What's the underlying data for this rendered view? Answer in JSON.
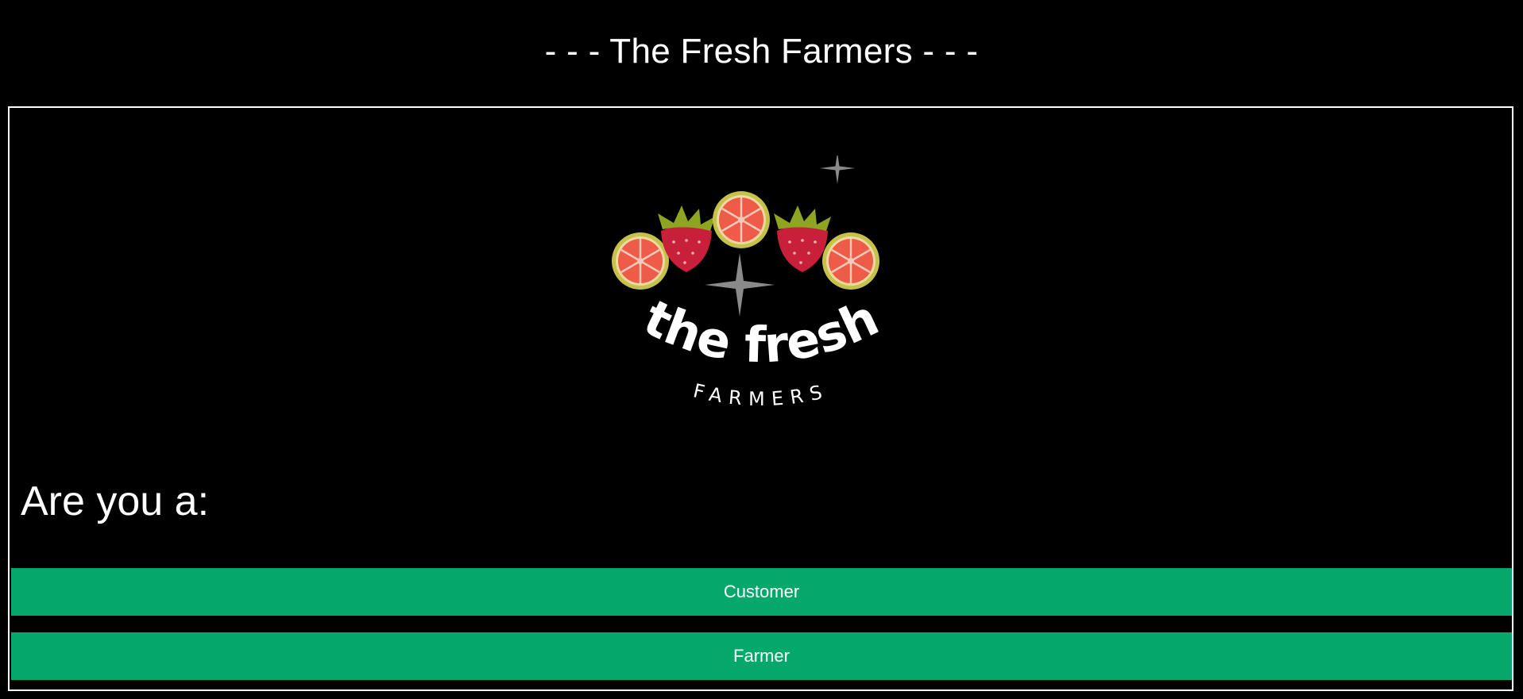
{
  "page": {
    "title": "- - - The Fresh Farmers - - -"
  },
  "logo": {
    "wordmark_top": "the fresh",
    "wordmark_bottom": "FARMERS",
    "icons": [
      "orange-slice-icon",
      "strawberry-icon",
      "orange-slice-icon",
      "strawberry-icon",
      "orange-slice-icon",
      "sparkle-icon",
      "sparkle-icon"
    ]
  },
  "role_selection": {
    "prompt": "Are you a:",
    "customer_label": "Customer",
    "farmer_label": "Farmer"
  },
  "colors": {
    "background": "#000000",
    "button": "#05a86b",
    "button_text": "#ffffff",
    "border": "#ffffff",
    "strawberry": "#c8203a",
    "leaf": "#8ea521",
    "orange_flesh": "#ee5b48",
    "orange_rind": "#c5c24a",
    "sparkle": "#8a8a8a"
  }
}
